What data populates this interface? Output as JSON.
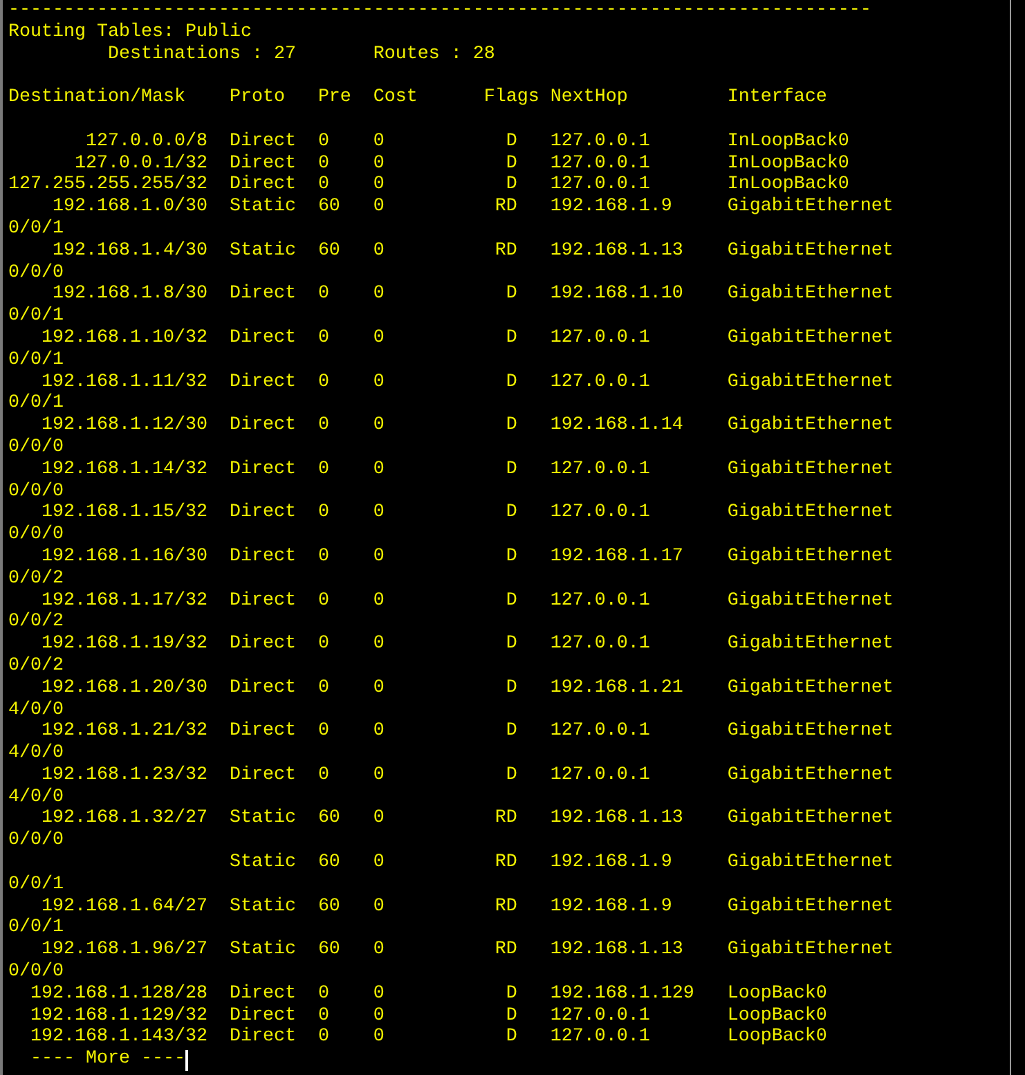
{
  "separator": "------------------------------------------------------------------------------",
  "title": "Routing Tables: Public",
  "summary": {
    "destinations": "Destinations : 27",
    "routes": "Routes : 28"
  },
  "columns": [
    "Destination/Mask",
    "Proto",
    "Pre",
    "Cost",
    "Flags",
    "NextHop",
    "Interface"
  ],
  "rows": [
    {
      "destination": "127.0.0.0/8",
      "proto": "Direct",
      "pre": "0",
      "cost": "0",
      "flags": "D",
      "nexthop": "127.0.0.1",
      "interface": "InLoopBack0"
    },
    {
      "destination": "127.0.0.1/32",
      "proto": "Direct",
      "pre": "0",
      "cost": "0",
      "flags": "D",
      "nexthop": "127.0.0.1",
      "interface": "InLoopBack0"
    },
    {
      "destination": "127.255.255.255/32",
      "proto": "Direct",
      "pre": "0",
      "cost": "0",
      "flags": "D",
      "nexthop": "127.0.0.1",
      "interface": "InLoopBack0"
    },
    {
      "destination": "192.168.1.0/30",
      "proto": "Static",
      "pre": "60",
      "cost": "0",
      "flags": "RD",
      "nexthop": "192.168.1.9",
      "interface": "GigabitEthernet",
      "wrap": "0/0/1"
    },
    {
      "destination": "192.168.1.4/30",
      "proto": "Static",
      "pre": "60",
      "cost": "0",
      "flags": "RD",
      "nexthop": "192.168.1.13",
      "interface": "GigabitEthernet",
      "wrap": "0/0/0"
    },
    {
      "destination": "192.168.1.8/30",
      "proto": "Direct",
      "pre": "0",
      "cost": "0",
      "flags": "D",
      "nexthop": "192.168.1.10",
      "interface": "GigabitEthernet",
      "wrap": "0/0/1"
    },
    {
      "destination": "192.168.1.10/32",
      "proto": "Direct",
      "pre": "0",
      "cost": "0",
      "flags": "D",
      "nexthop": "127.0.0.1",
      "interface": "GigabitEthernet",
      "wrap": "0/0/1"
    },
    {
      "destination": "192.168.1.11/32",
      "proto": "Direct",
      "pre": "0",
      "cost": "0",
      "flags": "D",
      "nexthop": "127.0.0.1",
      "interface": "GigabitEthernet",
      "wrap": "0/0/1"
    },
    {
      "destination": "192.168.1.12/30",
      "proto": "Direct",
      "pre": "0",
      "cost": "0",
      "flags": "D",
      "nexthop": "192.168.1.14",
      "interface": "GigabitEthernet",
      "wrap": "0/0/0"
    },
    {
      "destination": "192.168.1.14/32",
      "proto": "Direct",
      "pre": "0",
      "cost": "0",
      "flags": "D",
      "nexthop": "127.0.0.1",
      "interface": "GigabitEthernet",
      "wrap": "0/0/0"
    },
    {
      "destination": "192.168.1.15/32",
      "proto": "Direct",
      "pre": "0",
      "cost": "0",
      "flags": "D",
      "nexthop": "127.0.0.1",
      "interface": "GigabitEthernet",
      "wrap": "0/0/0"
    },
    {
      "destination": "192.168.1.16/30",
      "proto": "Direct",
      "pre": "0",
      "cost": "0",
      "flags": "D",
      "nexthop": "192.168.1.17",
      "interface": "GigabitEthernet",
      "wrap": "0/0/2"
    },
    {
      "destination": "192.168.1.17/32",
      "proto": "Direct",
      "pre": "0",
      "cost": "0",
      "flags": "D",
      "nexthop": "127.0.0.1",
      "interface": "GigabitEthernet",
      "wrap": "0/0/2"
    },
    {
      "destination": "192.168.1.19/32",
      "proto": "Direct",
      "pre": "0",
      "cost": "0",
      "flags": "D",
      "nexthop": "127.0.0.1",
      "interface": "GigabitEthernet",
      "wrap": "0/0/2"
    },
    {
      "destination": "192.168.1.20/30",
      "proto": "Direct",
      "pre": "0",
      "cost": "0",
      "flags": "D",
      "nexthop": "192.168.1.21",
      "interface": "GigabitEthernet",
      "wrap": "4/0/0"
    },
    {
      "destination": "192.168.1.21/32",
      "proto": "Direct",
      "pre": "0",
      "cost": "0",
      "flags": "D",
      "nexthop": "127.0.0.1",
      "interface": "GigabitEthernet",
      "wrap": "4/0/0"
    },
    {
      "destination": "192.168.1.23/32",
      "proto": "Direct",
      "pre": "0",
      "cost": "0",
      "flags": "D",
      "nexthop": "127.0.0.1",
      "interface": "GigabitEthernet",
      "wrap": "4/0/0"
    },
    {
      "destination": "192.168.1.32/27",
      "proto": "Static",
      "pre": "60",
      "cost": "0",
      "flags": "RD",
      "nexthop": "192.168.1.13",
      "interface": "GigabitEthernet",
      "wrap": "0/0/0"
    },
    {
      "proto": "Static",
      "pre": "60",
      "cost": "0",
      "flags": "RD",
      "nexthop": "192.168.1.9",
      "interface": "GigabitEthernet",
      "wrap": "0/0/1"
    },
    {
      "destination": "192.168.1.64/27",
      "proto": "Static",
      "pre": "60",
      "cost": "0",
      "flags": "RD",
      "nexthop": "192.168.1.9",
      "interface": "GigabitEthernet",
      "wrap": "0/0/1"
    },
    {
      "destination": "192.168.1.96/27",
      "proto": "Static",
      "pre": "60",
      "cost": "0",
      "flags": "RD",
      "nexthop": "192.168.1.13",
      "interface": "GigabitEthernet",
      "wrap": "0/0/0"
    },
    {
      "destination": "192.168.1.128/28",
      "proto": "Direct",
      "pre": "0",
      "cost": "0",
      "flags": "D",
      "nexthop": "192.168.1.129",
      "interface": "LoopBack0"
    },
    {
      "destination": "192.168.1.129/32",
      "proto": "Direct",
      "pre": "0",
      "cost": "0",
      "flags": "D",
      "nexthop": "127.0.0.1",
      "interface": "LoopBack0"
    },
    {
      "destination": "192.168.1.143/32",
      "proto": "Direct",
      "pre": "0",
      "cost": "0",
      "flags": "D",
      "nexthop": "127.0.0.1",
      "interface": "LoopBack0"
    }
  ],
  "more_prompt": "---- More ----"
}
